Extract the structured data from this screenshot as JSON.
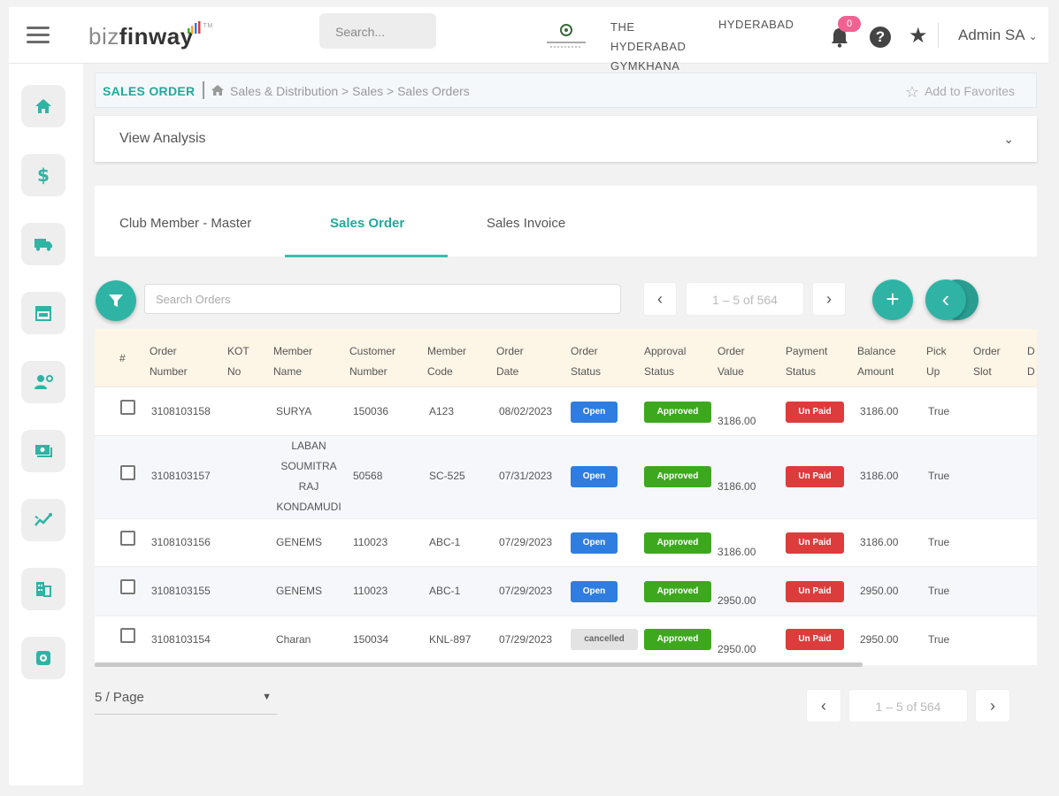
{
  "header": {
    "logo_prefix": "biz",
    "logo_main": "finway",
    "logo_tm": "TM",
    "search_placeholder": "Search...",
    "club_name_lines": [
      "THE",
      "HYDERABAD",
      "GYMKHANA"
    ],
    "city": "HYDERABAD",
    "notification_count": "0",
    "help_glyph": "?",
    "user_name": "Admin SA"
  },
  "sidebar": {
    "items": [
      "home-icon",
      "dollar-icon",
      "truck-icon",
      "store-icon",
      "user-settings-icon",
      "cash-icon",
      "analytics-icon",
      "building-icon",
      "settings-icon"
    ]
  },
  "breadcrumb": {
    "title": "SALES ORDER",
    "path": "Sales & Distribution > Sales > Sales Orders",
    "favorites_label": "Add to Favorites"
  },
  "analysis": {
    "label": "View Analysis"
  },
  "tabs": [
    {
      "label": "Club Member - Master",
      "active": false
    },
    {
      "label": "Sales Order",
      "active": true
    },
    {
      "label": "Sales Invoice",
      "active": false
    }
  ],
  "toolbar": {
    "search_placeholder": "Search Orders",
    "page_info": "1 – 5 of 564",
    "prev": "‹",
    "next": "›",
    "add": "+",
    "collapse": "‹"
  },
  "table": {
    "columns": [
      [
        "#"
      ],
      [
        "Order",
        "Number"
      ],
      [
        "KOT",
        "No"
      ],
      [
        "Member",
        "Name"
      ],
      [
        "Customer",
        "Number"
      ],
      [
        "Member",
        "Code"
      ],
      [
        "Order",
        "Date"
      ],
      [
        "Order",
        "Status"
      ],
      [
        "Approval",
        "Status"
      ],
      [
        "Order",
        "Value"
      ],
      [
        "Payment",
        "Status"
      ],
      [
        "Balance",
        "Amount"
      ],
      [
        "Pick",
        "Up"
      ],
      [
        "Order",
        "Slot"
      ],
      [
        "D",
        "D"
      ]
    ],
    "rows": [
      {
        "order_number": "3108103158",
        "member_name": [
          "SURYA"
        ],
        "customer_number": "150036",
        "member_code": "A123",
        "order_date": "08/02/2023",
        "order_status": "Open",
        "approval_status": "Approved",
        "order_value": "3186.00",
        "payment_status": "Un Paid",
        "balance_amount": "3186.00",
        "pick_up": "True"
      },
      {
        "order_number": "3108103157",
        "member_name": [
          "LABAN",
          "SOUMITRA",
          "RAJ",
          "KONDAMUDI"
        ],
        "customer_number": "50568",
        "member_code": "SC-525",
        "order_date": "07/31/2023",
        "order_status": "Open",
        "approval_status": "Approved",
        "order_value": "3186.00",
        "payment_status": "Un Paid",
        "balance_amount": "3186.00",
        "pick_up": "True"
      },
      {
        "order_number": "3108103156",
        "member_name": [
          "GENEMS"
        ],
        "customer_number": "110023",
        "member_code": "ABC-1",
        "order_date": "07/29/2023",
        "order_status": "Open",
        "approval_status": "Approved",
        "order_value": "3186.00",
        "payment_status": "Un Paid",
        "balance_amount": "3186.00",
        "pick_up": "True"
      },
      {
        "order_number": "3108103155",
        "member_name": [
          "GENEMS"
        ],
        "customer_number": "110023",
        "member_code": "ABC-1",
        "order_date": "07/29/2023",
        "order_status": "Open",
        "approval_status": "Approved",
        "order_value": "2950.00",
        "payment_status": "Un Paid",
        "balance_amount": "2950.00",
        "pick_up": "True"
      },
      {
        "order_number": "3108103154",
        "member_name": [
          "Charan"
        ],
        "customer_number": "150034",
        "member_code": "KNL-897",
        "order_date": "07/29/2023",
        "order_status": "cancelled",
        "approval_status": "Approved",
        "order_value": "2950.00",
        "payment_status": "Un Paid",
        "balance_amount": "2950.00",
        "pick_up": "True"
      }
    ]
  },
  "footer": {
    "per_page": "5 / Page",
    "page_info": "1 – 5 of 564",
    "prev": "‹",
    "next": "›"
  },
  "colors": {
    "accent": "#2fb3a5",
    "open": "#2f7de1",
    "approved": "#3da81e",
    "unpaid": "#dc3c3c",
    "header_row": "#fdf5e6"
  }
}
